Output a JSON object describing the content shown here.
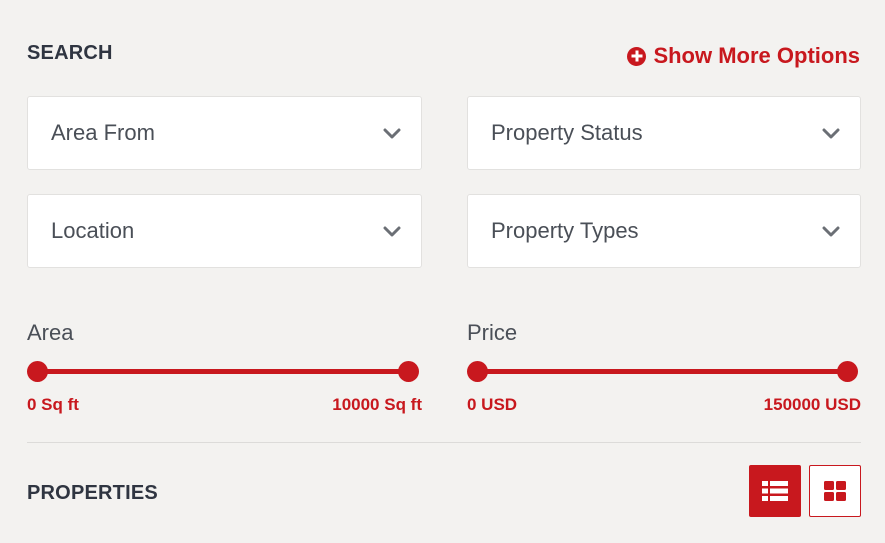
{
  "search": {
    "title": "SEARCH",
    "more_options_label": "Show More Options"
  },
  "filters": {
    "area_from": "Area From",
    "property_status": "Property Status",
    "location": "Location",
    "property_types": "Property Types"
  },
  "area": {
    "label": "Area",
    "min_value": "0 Sq ft",
    "max_value": "10000 Sq ft",
    "min_fraction": 0,
    "max_fraction": 1
  },
  "price": {
    "label": "Price",
    "min_value": "0 USD",
    "max_value": "150000 USD",
    "min_fraction": 0,
    "max_fraction": 1
  },
  "properties": {
    "title": "PROPERTIES",
    "active_view": "list"
  },
  "icons": {
    "more_options": "plus-circle-icon",
    "dropdown": "chevron-down-icon",
    "list_view": "list-icon",
    "grid_view": "grid-icon"
  },
  "colors": {
    "accent": "#c8181e",
    "text_dark": "#2f3541",
    "text_muted": "#4a4f57",
    "background": "#f3f2f0"
  }
}
